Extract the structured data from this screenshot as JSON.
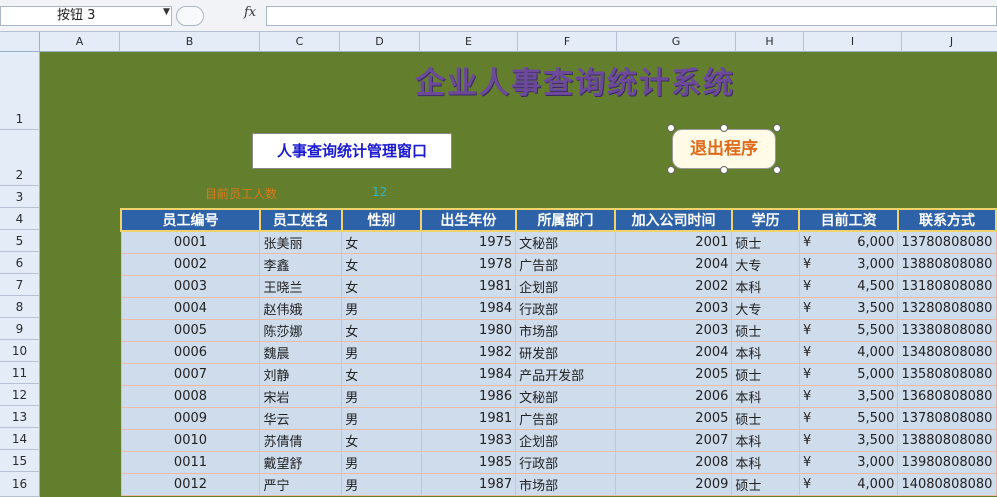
{
  "formula_bar": {
    "name_box": "按钮 3",
    "fx_label": "fx",
    "formula": ""
  },
  "columns": [
    "A",
    "B",
    "C",
    "D",
    "E",
    "F",
    "G",
    "H",
    "I",
    "J"
  ],
  "rows": [
    "1",
    "2",
    "3",
    "4",
    "5",
    "6",
    "7",
    "8",
    "9",
    "10",
    "11",
    "12",
    "13",
    "14",
    "15",
    "16"
  ],
  "sheet": {
    "title": "企业人事查询统计系统",
    "query_button": "人事查询统计管理窗口",
    "exit_button": "退出程序",
    "count_label": "目前员工人数",
    "count_value": "12"
  },
  "table": {
    "headers": [
      "员工编号",
      "员工姓名",
      "性别",
      "出生年份",
      "所属部门",
      "加入公司时间",
      "学历",
      "目前工资",
      "联系方式"
    ],
    "rows": [
      {
        "id": "0001",
        "name": "张美丽",
        "gender": "女",
        "birth": "1975",
        "dept": "文秘部",
        "join": "2001",
        "edu": "硕士",
        "currency": "¥",
        "salary": "6,000",
        "phone": "13780808080"
      },
      {
        "id": "0002",
        "name": "李鑫",
        "gender": "女",
        "birth": "1978",
        "dept": "广告部",
        "join": "2004",
        "edu": "大专",
        "currency": "¥",
        "salary": "3,000",
        "phone": "13880808080"
      },
      {
        "id": "0003",
        "name": "王晓兰",
        "gender": "女",
        "birth": "1981",
        "dept": "企划部",
        "join": "2002",
        "edu": "本科",
        "currency": "¥",
        "salary": "4,500",
        "phone": "13180808080"
      },
      {
        "id": "0004",
        "name": "赵伟娥",
        "gender": "男",
        "birth": "1984",
        "dept": "行政部",
        "join": "2003",
        "edu": "大专",
        "currency": "¥",
        "salary": "3,500",
        "phone": "13280808080"
      },
      {
        "id": "0005",
        "name": "陈莎娜",
        "gender": "女",
        "birth": "1980",
        "dept": "市场部",
        "join": "2003",
        "edu": "硕士",
        "currency": "¥",
        "salary": "5,500",
        "phone": "13380808080"
      },
      {
        "id": "0006",
        "name": "魏晨",
        "gender": "男",
        "birth": "1982",
        "dept": "研发部",
        "join": "2004",
        "edu": "本科",
        "currency": "¥",
        "salary": "4,000",
        "phone": "13480808080"
      },
      {
        "id": "0007",
        "name": "刘静",
        "gender": "女",
        "birth": "1984",
        "dept": "产品开发部",
        "join": "2005",
        "edu": "硕士",
        "currency": "¥",
        "salary": "5,000",
        "phone": "13580808080"
      },
      {
        "id": "0008",
        "name": "宋岩",
        "gender": "男",
        "birth": "1986",
        "dept": "文秘部",
        "join": "2006",
        "edu": "本科",
        "currency": "¥",
        "salary": "3,500",
        "phone": "13680808080"
      },
      {
        "id": "0009",
        "name": "华云",
        "gender": "男",
        "birth": "1981",
        "dept": "广告部",
        "join": "2005",
        "edu": "硕士",
        "currency": "¥",
        "salary": "5,500",
        "phone": "13780808080"
      },
      {
        "id": "0010",
        "name": "苏倩倩",
        "gender": "女",
        "birth": "1983",
        "dept": "企划部",
        "join": "2007",
        "edu": "本科",
        "currency": "¥",
        "salary": "3,500",
        "phone": "13880808080"
      },
      {
        "id": "0011",
        "name": "戴望舒",
        "gender": "男",
        "birth": "1985",
        "dept": "行政部",
        "join": "2008",
        "edu": "本科",
        "currency": "¥",
        "salary": "3,000",
        "phone": "13980808080"
      },
      {
        "id": "0012",
        "name": "严宁",
        "gender": "男",
        "birth": "1987",
        "dept": "市场部",
        "join": "2009",
        "edu": "硕士",
        "currency": "¥",
        "salary": "4,000",
        "phone": "14080808080"
      }
    ]
  },
  "colors": {
    "sheet_bg": "#637f2e",
    "header_bg": "#2d62a8",
    "cell_bg": "#cfdcec",
    "title": "#6b4a9a",
    "exit_text": "#e06a1a"
  }
}
